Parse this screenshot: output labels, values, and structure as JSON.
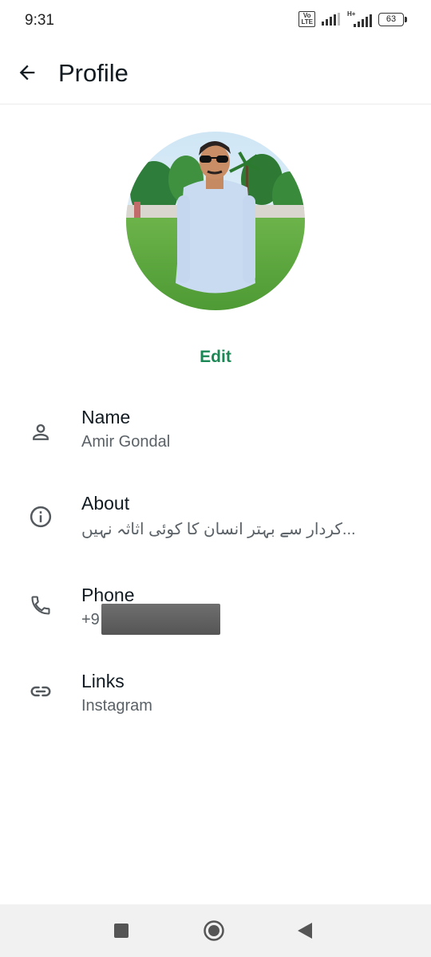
{
  "status_bar": {
    "time": "9:31",
    "volte": "Vo\nLTE",
    "network": "H+",
    "battery": "63"
  },
  "app_bar": {
    "title": "Profile"
  },
  "profile": {
    "edit_label": "Edit",
    "fields": [
      {
        "icon": "person-icon",
        "label": "Name",
        "value": "Amir Gondal"
      },
      {
        "icon": "info-icon",
        "label": "About",
        "value": "کردار سے بہتر انسان کا کوئی اثاثہ نہیں..."
      },
      {
        "icon": "phone-icon",
        "label": "Phone",
        "value": "+9"
      },
      {
        "icon": "link-icon",
        "label": "Links",
        "value": "Instagram"
      }
    ]
  },
  "colors": {
    "accent": "#1b8755",
    "text": "#111b21",
    "secondary": "#5a6167",
    "nav_bg": "#f1f1f1"
  },
  "nav_bar": {
    "buttons": [
      "recents-square-icon",
      "home-circle-icon",
      "back-triangle-icon"
    ]
  }
}
